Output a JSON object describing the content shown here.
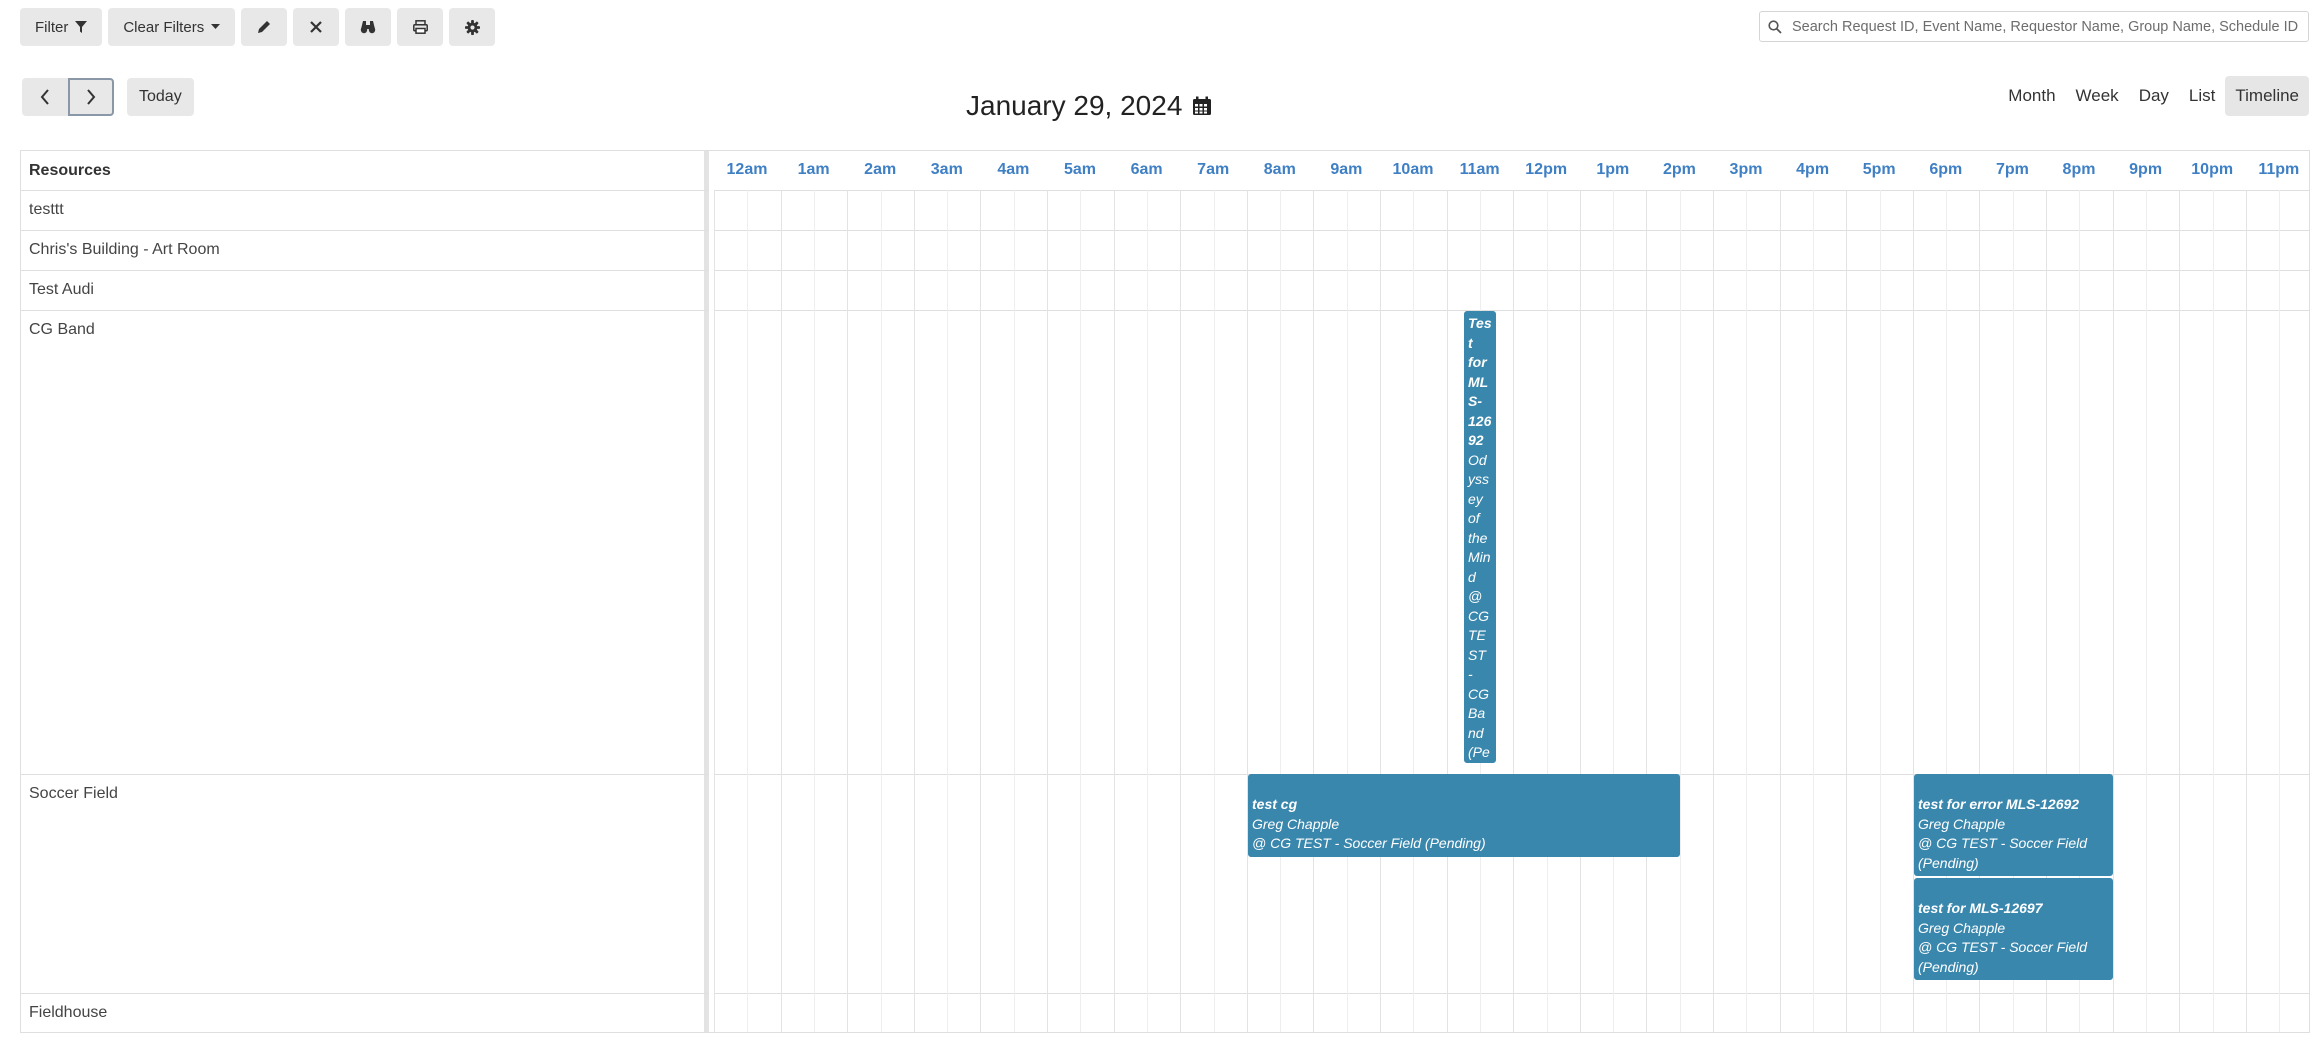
{
  "toolbar": {
    "filter_label": "Filter",
    "clear_filters_label": "Clear Filters"
  },
  "search": {
    "placeholder": "Search Request ID, Event Name, Requestor Name, Group Name, Schedule ID"
  },
  "nav": {
    "today_label": "Today",
    "date_title": "January 29, 2024"
  },
  "views": [
    "Month",
    "Week",
    "Day",
    "List",
    "Timeline"
  ],
  "active_view": "Timeline",
  "timeline": {
    "resources_header": "Resources",
    "hours": [
      "12am",
      "1am",
      "2am",
      "3am",
      "4am",
      "5am",
      "6am",
      "7am",
      "8am",
      "9am",
      "10am",
      "11am",
      "12pm",
      "1pm",
      "2pm",
      "3pm",
      "4pm",
      "5pm",
      "6pm",
      "7pm",
      "8pm",
      "9pm",
      "10pm",
      "11pm"
    ],
    "resources": [
      {
        "name": "testtt"
      },
      {
        "name": "Chris's Building - Art Room"
      },
      {
        "name": "Test Audi"
      },
      {
        "name": "CG Band"
      },
      {
        "name": "Soccer Field"
      },
      {
        "name": "Fieldhouse"
      }
    ],
    "events": [
      {
        "resource": "CG Band",
        "title": "Test for MLS-12692",
        "line1": "Odyssey of the Mind",
        "line2": "@ CG TEST - CG Band (Pending)"
      },
      {
        "resource": "Soccer Field",
        "title": "test cg",
        "line1": "Greg Chapple",
        "line2": "@ CG TEST - Soccer Field (Pending)"
      },
      {
        "resource": "Soccer Field",
        "title": "test for error MLS-12692",
        "line1": "Greg Chapple",
        "line2": "@ CG TEST - Soccer Field (Pending)"
      },
      {
        "resource": "Soccer Field",
        "title": "test for MLS-12697",
        "line1": "Greg Chapple",
        "line2": "@ CG TEST - Soccer Field (Pending)"
      }
    ]
  },
  "colors": {
    "event_bg": "#3a87ad",
    "hour_label": "#3f7fc4"
  }
}
